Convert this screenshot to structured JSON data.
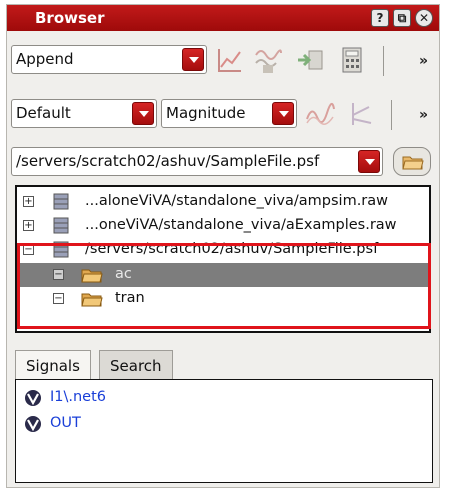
{
  "window": {
    "title": "Browser"
  },
  "title_buttons": {
    "help": "?",
    "restore": "⧉",
    "close": "✕"
  },
  "toolbar1": {
    "plot_mode": "Append",
    "more": "»"
  },
  "toolbar2": {
    "graph_type": "Default",
    "modifier": "Magnitude",
    "more": "»"
  },
  "file_select": {
    "value": "/servers/scratch02/ashuv/SampleFile.psf"
  },
  "tree": {
    "items": [
      {
        "label": "...aloneViVA/standalone_viva/ampsim.raw",
        "expander": "+"
      },
      {
        "label": "...oneViVA/standalone_viva/aExamples.raw",
        "expander": "+"
      },
      {
        "label": "/servers/scratch02/ashuv/SampleFile.psf",
        "expander": "−"
      },
      {
        "label": "ac",
        "expander": "−"
      },
      {
        "label": "tran",
        "expander": "−"
      }
    ]
  },
  "tabs": [
    {
      "label": "Signals"
    },
    {
      "label": "Search"
    }
  ],
  "signals": [
    {
      "label": "I1\\.net6"
    },
    {
      "label": "OUT"
    }
  ],
  "colors": {
    "titlebar": "#b01212",
    "highlight": "#e0141b",
    "signal_text": "#1a3fd8"
  }
}
